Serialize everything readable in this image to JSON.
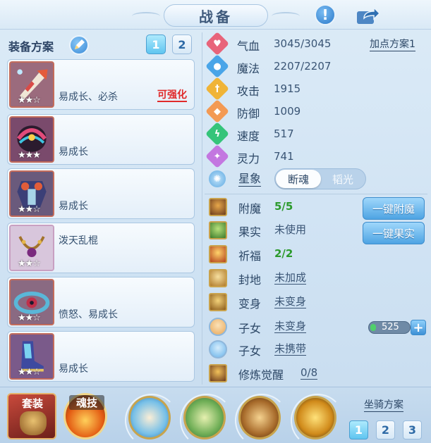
{
  "header": {
    "title": "战备"
  },
  "equip_plan": {
    "label": "装备方案",
    "tabs": [
      "1",
      "2"
    ],
    "active_tab": "1"
  },
  "equipment": [
    {
      "desc": "易成长、必杀",
      "action": "可强化"
    },
    {
      "desc": "易成长"
    },
    {
      "desc": "易成长"
    },
    {
      "desc": "泼天乱棍"
    },
    {
      "desc": "愤怒、易成长"
    },
    {
      "desc": "易成长"
    }
  ],
  "attribute_plan": "加点方案1",
  "stats": [
    {
      "label": "气血",
      "value": "3045/3045",
      "color": "#e8647a",
      "icon": "heart-icon"
    },
    {
      "label": "魔法",
      "value": "2207/2207",
      "color": "#4aa5e8",
      "icon": "mana-icon"
    },
    {
      "label": "攻击",
      "value": "1915",
      "color": "#f0b437",
      "icon": "sword-icon"
    },
    {
      "label": "防御",
      "value": "1009",
      "color": "#f39a54",
      "icon": "shield-icon"
    },
    {
      "label": "速度",
      "value": "517",
      "color": "#35c47a",
      "icon": "speed-icon"
    },
    {
      "label": "灵力",
      "value": "741",
      "color": "#c377e0",
      "icon": "spirit-icon"
    }
  ],
  "xingxiang": {
    "label": "星象",
    "options": [
      "断魂",
      "韬光"
    ],
    "selected": "断魂"
  },
  "features": [
    {
      "label": "附魔",
      "value": "5/5",
      "style": "green",
      "icon": "enchant-icon"
    },
    {
      "label": "果实",
      "value": "未使用",
      "style": "plain",
      "icon": "fruit-icon"
    },
    {
      "label": "祈福",
      "value": "2/2",
      "style": "green",
      "icon": "blessing-icon"
    },
    {
      "label": "封地",
      "value": "未加成",
      "style": "ul",
      "icon": "fief-icon"
    },
    {
      "label": "变身",
      "value": "未变身",
      "style": "ul",
      "icon": "transform-icon"
    },
    {
      "label": "子女",
      "value": "未变身",
      "style": "ul",
      "icon": "child-icon"
    },
    {
      "label": "子女",
      "value": "未携带",
      "style": "ul",
      "icon": "paw-icon"
    },
    {
      "label": "修炼觉醒",
      "value": "0/8",
      "style": "ul",
      "icon": "cultivation-icon"
    }
  ],
  "side_buttons": {
    "enchant": "一键附魔",
    "fruit": "一键果实"
  },
  "counter": {
    "value": "525",
    "plus": "+"
  },
  "bottom": {
    "set_label": "套装",
    "soul_label": "魂技",
    "mount_plan": {
      "label": "坐骑方案",
      "tabs": [
        "1",
        "2",
        "3"
      ],
      "active_tab": "1"
    }
  }
}
